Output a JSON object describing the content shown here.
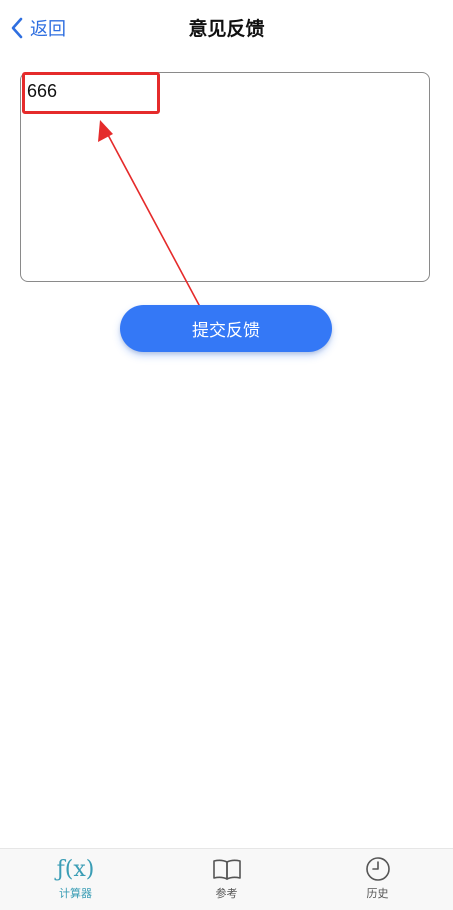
{
  "header": {
    "back_label": "返回",
    "title": "意见反馈",
    "accent_color": "#2f6fe0"
  },
  "feedback": {
    "value": "666"
  },
  "submit": {
    "label": "提交反馈",
    "color": "#3478f6"
  },
  "annotation": {
    "color": "#e52b2b"
  },
  "tabs": [
    {
      "label": "计算器",
      "icon": "fx-icon",
      "glyph": "ƒ(x)",
      "active": true
    },
    {
      "label": "参考",
      "icon": "book-icon",
      "active": false
    },
    {
      "label": "历史",
      "icon": "clock-icon",
      "active": false
    }
  ],
  "active_tab_color": "#3a9db5"
}
